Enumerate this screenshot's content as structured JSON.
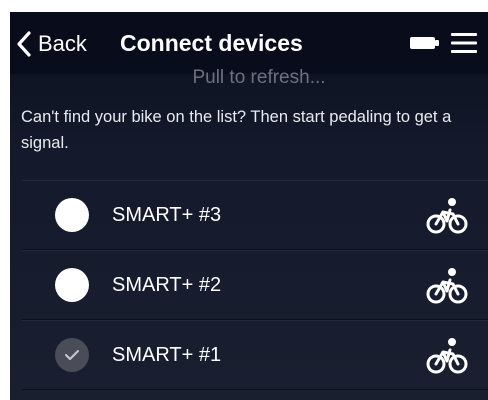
{
  "header": {
    "back_label": "Back",
    "title": "Connect devices",
    "battery_icon": "battery-icon",
    "menu_icon": "hamburger-menu-icon"
  },
  "pull_to_refresh": "Pull to refresh...",
  "hint": "Can't find your bike on the list? Then start pedaling to get a signal.",
  "devices": [
    {
      "name": "SMART+ #3",
      "selected": false,
      "icon": "bike-icon"
    },
    {
      "name": "SMART+ #2",
      "selected": false,
      "icon": "bike-icon"
    },
    {
      "name": "SMART+ #1",
      "selected": true,
      "icon": "bike-icon"
    }
  ],
  "colors": {
    "background": "#14192b",
    "header": "#090c1a",
    "text": "#ffffff",
    "muted": "#6c7080",
    "selected_radio": "#4a4d57"
  }
}
